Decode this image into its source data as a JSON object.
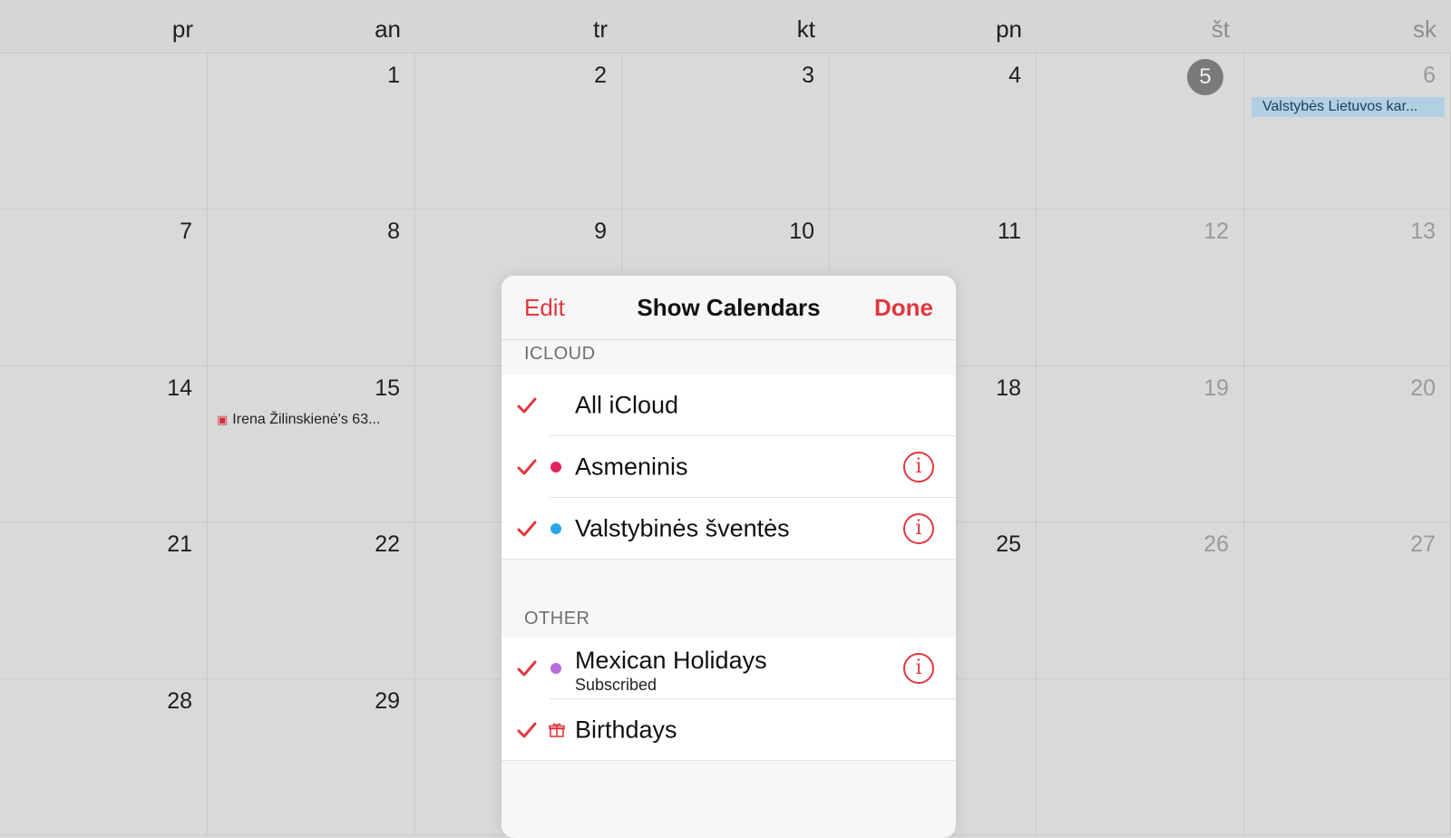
{
  "weekdays": [
    "pr",
    "an",
    "tr",
    "kt",
    "pn",
    "št",
    "sk"
  ],
  "weeks": [
    [
      "",
      "1",
      "2",
      "3",
      "4",
      "5",
      "6"
    ],
    [
      "7",
      "8",
      "9",
      "10",
      "11",
      "12",
      "13"
    ],
    [
      "14",
      "15",
      "",
      "",
      "18",
      "19",
      "20"
    ],
    [
      "21",
      "22",
      "",
      "",
      "25",
      "26",
      "27"
    ],
    [
      "28",
      "29",
      "",
      "",
      "",
      "",
      ""
    ]
  ],
  "today": "5",
  "events": {
    "holiday_6": "Valstybės Lietuvos kar...",
    "birthday_15": "Irena Žilinskienė's 63..."
  },
  "popover": {
    "edit_label": "Edit",
    "title": "Show Calendars",
    "done_label": "Done",
    "section_icloud": "ICLOUD",
    "section_other": "OTHER",
    "items": [
      {
        "label": "All iCloud",
        "checked": true
      },
      {
        "label": "Asmeninis",
        "checked": true,
        "color": "#e0245e"
      },
      {
        "label": "Valstybinės šventės",
        "checked": true,
        "color": "#2aa7e8"
      },
      {
        "label": "Mexican Holidays",
        "sub": "Subscribed",
        "checked": true,
        "color": "#b56bdc"
      },
      {
        "label": "Birthdays",
        "checked": true,
        "icon": "gift-icon"
      }
    ]
  },
  "colors": {
    "accent": "#e0383e",
    "today_circle": "#7a7a7a",
    "holiday_event": "#b2d0e4"
  }
}
